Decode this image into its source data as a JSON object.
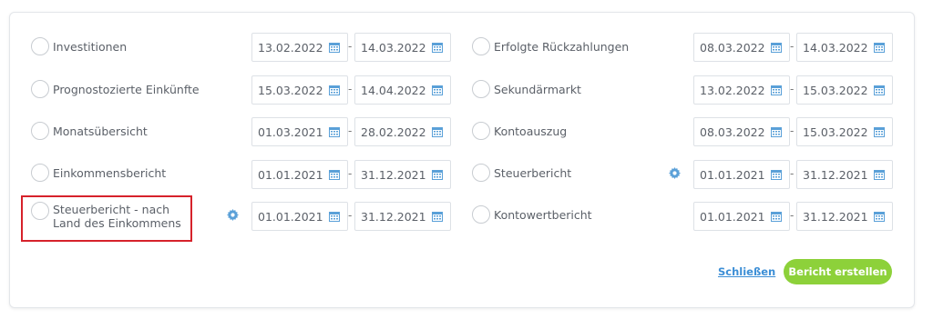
{
  "left_column": [
    {
      "label": "Investitionen",
      "from": "13.02.2022",
      "to": "14.03.2022",
      "gear": false
    },
    {
      "label": "Prognostozierte Einkünfte",
      "from": "15.03.2022",
      "to": "14.04.2022",
      "gear": false
    },
    {
      "label": "Monatsübersicht",
      "from": "01.03.2021",
      "to": "28.02.2022",
      "gear": false
    },
    {
      "label": "Einkommensbericht",
      "from": "01.01.2021",
      "to": "31.12.2021",
      "gear": false
    },
    {
      "label": "Steuerbericht - nach Land des Einkommens",
      "from": "01.01.2021",
      "to": "31.12.2021",
      "gear": true
    }
  ],
  "right_column": [
    {
      "label": "Erfolgte Rückzahlungen",
      "from": "08.03.2022",
      "to": "14.03.2022",
      "gear": false
    },
    {
      "label": "Sekundärmarkt",
      "from": "13.02.2022",
      "to": "15.03.2022",
      "gear": false
    },
    {
      "label": "Kontoauszug",
      "from": "08.03.2022",
      "to": "15.03.2022",
      "gear": false
    },
    {
      "label": "Steuerbericht",
      "from": "01.01.2021",
      "to": "31.12.2021",
      "gear": true
    },
    {
      "label": "Kontowertbericht",
      "from": "01.01.2021",
      "to": "31.12.2021",
      "gear": false
    }
  ],
  "date_separator": "-",
  "footer": {
    "close_label": "Schließen",
    "create_label": "Bericht erstellen"
  },
  "icons": {
    "calendar": "calendar-icon",
    "settings": "gear-icon"
  },
  "colors": {
    "accent_green": "#8dd13a",
    "link_blue": "#3d8fd6",
    "icon_blue": "#5aa0d8",
    "highlight_red": "#d6222b"
  }
}
